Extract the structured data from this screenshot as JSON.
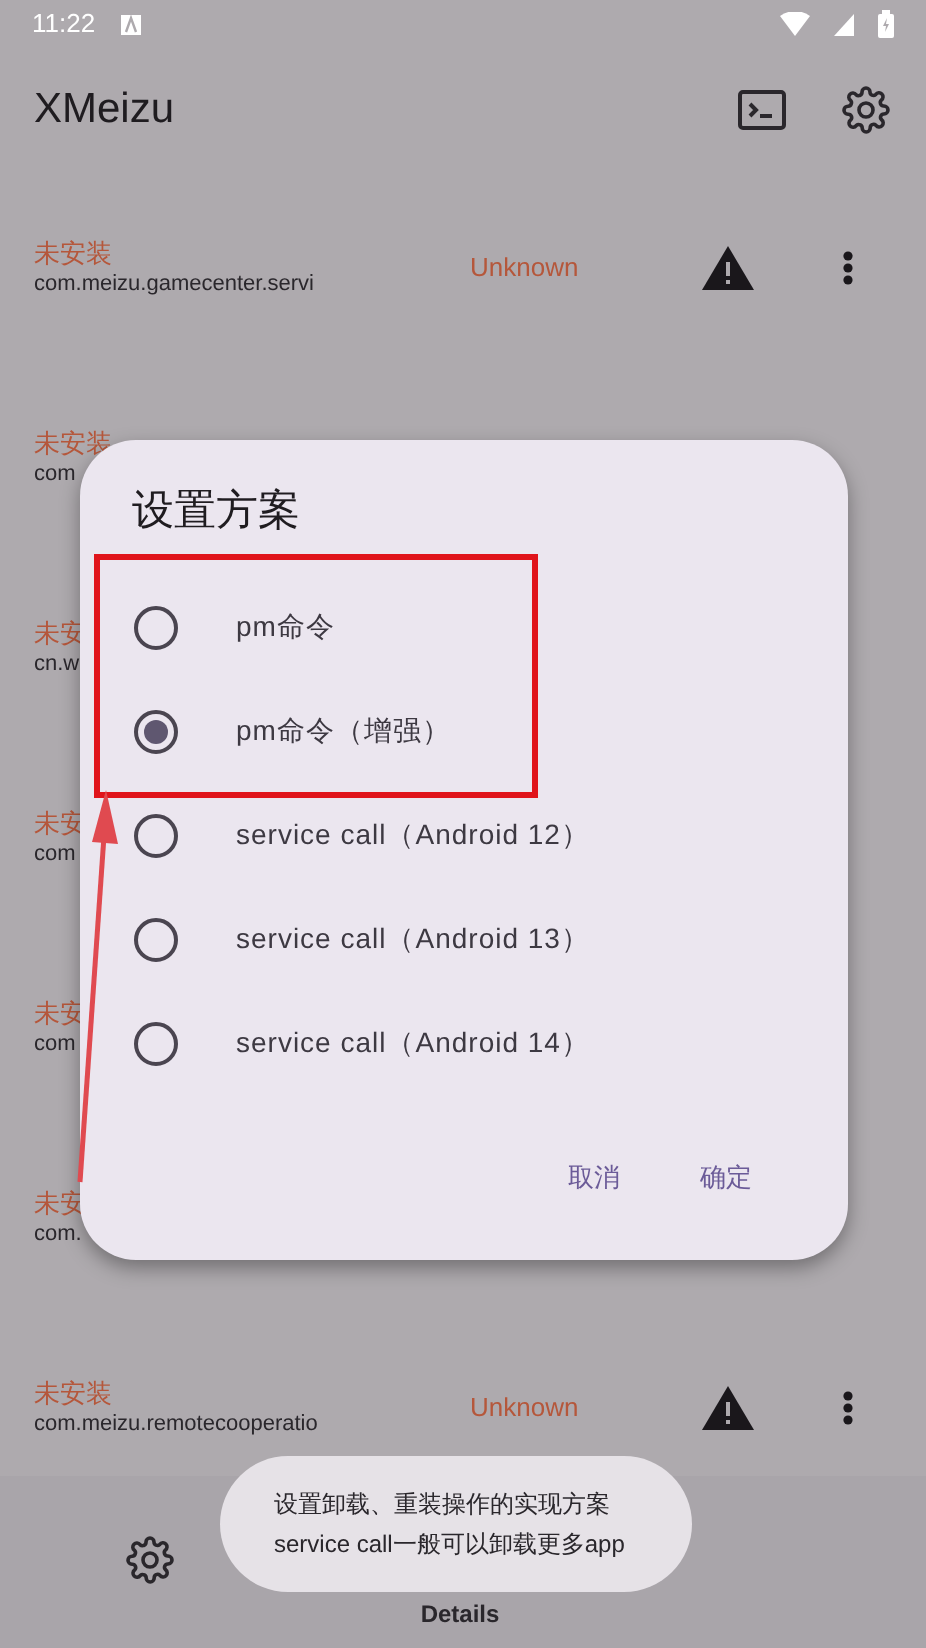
{
  "status_bar": {
    "time": "11:22"
  },
  "app_bar": {
    "title": "XMeizu"
  },
  "packages": [
    {
      "status": "未安装",
      "name": "com.meizu.gamecenter.servi",
      "version": "Unknown"
    },
    {
      "status": "未安装",
      "name": "com"
    },
    {
      "status": "未安",
      "name": "cn.w"
    },
    {
      "status": "未安",
      "name": "com"
    },
    {
      "status": "未安",
      "name": "com"
    },
    {
      "status": "未安",
      "name": "com."
    },
    {
      "status": "未安装",
      "name": "com.meizu.remotecooperatio",
      "version": "Unknown"
    }
  ],
  "bottom_nav": {
    "label": "Details"
  },
  "dialog": {
    "title": "设置方案",
    "options": [
      {
        "label": "pm命令",
        "selected": false
      },
      {
        "label": "pm命令（增强）",
        "selected": true
      },
      {
        "label": "service call（Android 12）",
        "selected": false
      },
      {
        "label": "service call（Android 13）",
        "selected": false
      },
      {
        "label": "service call（Android 14）",
        "selected": false
      }
    ],
    "buttons": [
      "取消",
      "确定"
    ]
  },
  "toast": {
    "lines": [
      "设置卸载、重装操作的实现方案",
      "service call一般可以卸载更多app"
    ]
  }
}
